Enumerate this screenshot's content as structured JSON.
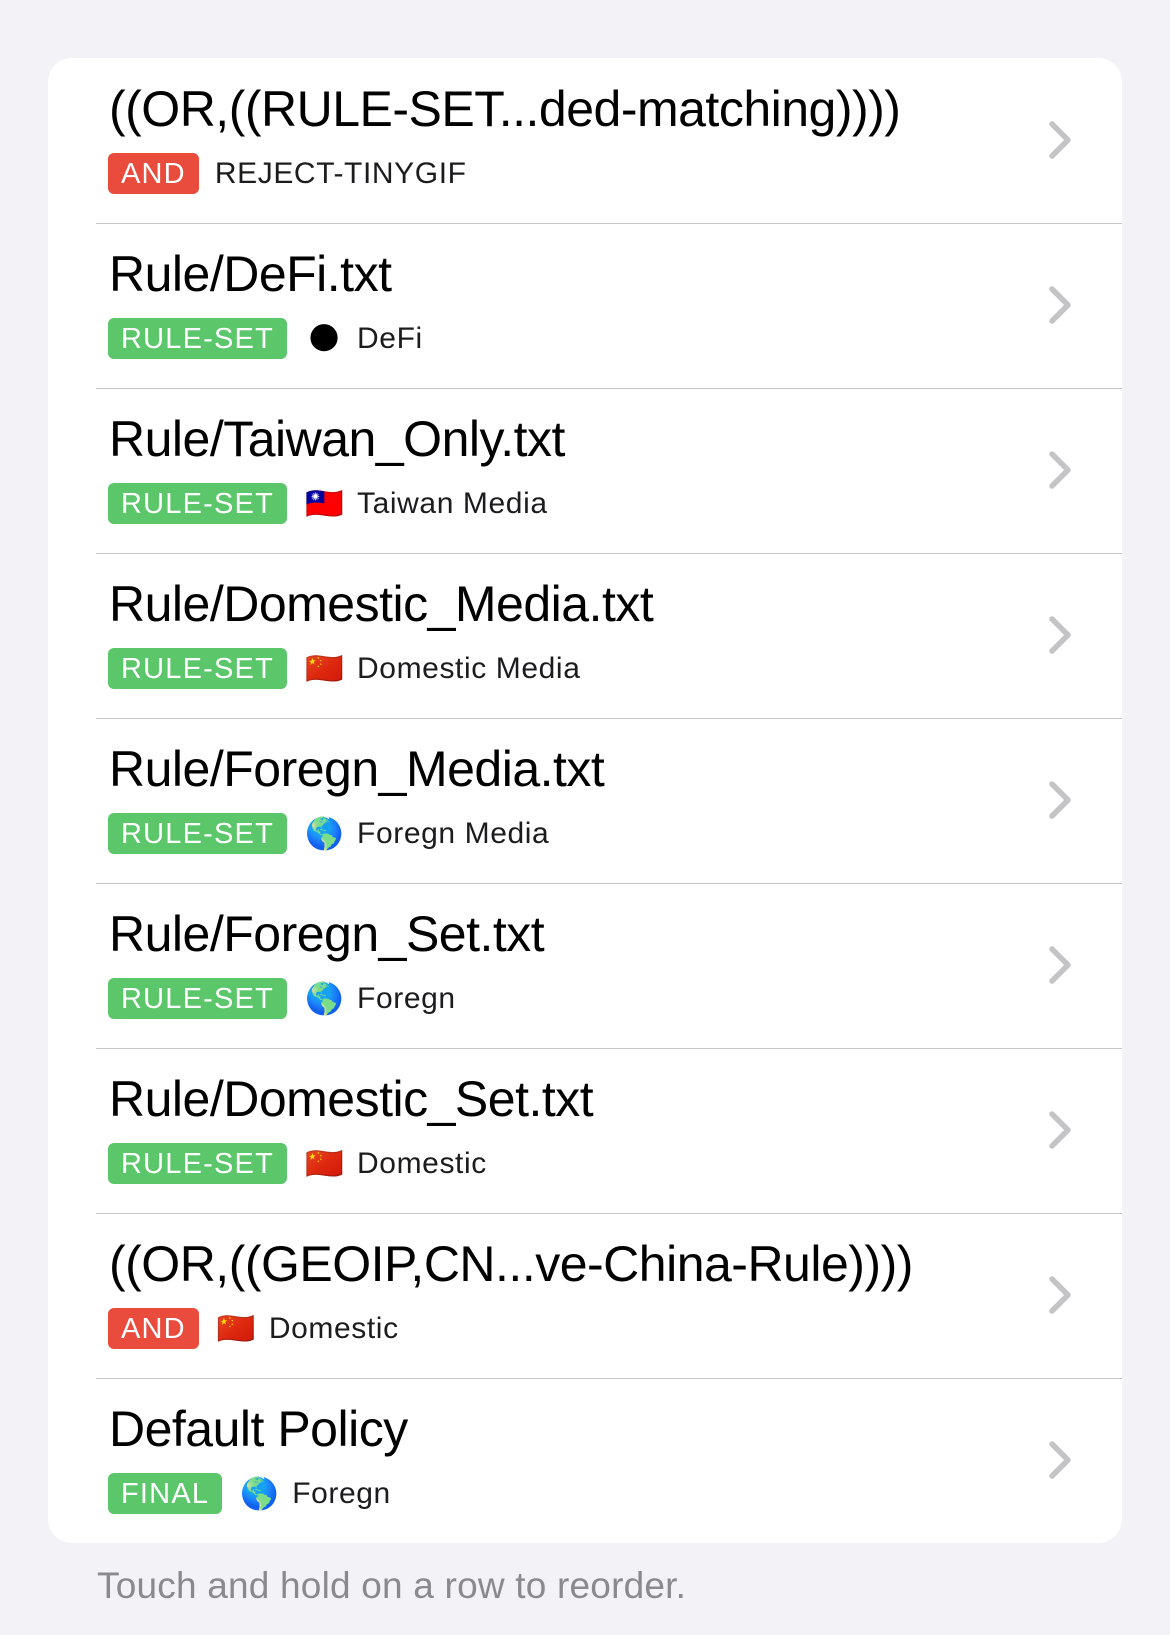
{
  "rules": [
    {
      "title": "((OR,((RULE-SET...ded-matching))))",
      "type": "AND",
      "type_color": "#e94b3c",
      "flag": "",
      "policy": "REJECT-TINYGIF"
    },
    {
      "title": "Rule/DeFi.txt",
      "type": "RULE-SET",
      "type_color": "#5cc66a",
      "flag": "🌑",
      "policy": "DeFi"
    },
    {
      "title": "Rule/Taiwan_Only.txt",
      "type": "RULE-SET",
      "type_color": "#5cc66a",
      "flag": "🇹🇼",
      "policy": "Taiwan Media"
    },
    {
      "title": "Rule/Domestic_Media.txt",
      "type": "RULE-SET",
      "type_color": "#5cc66a",
      "flag": "🇨🇳",
      "policy": "Domestic Media"
    },
    {
      "title": "Rule/Foregn_Media.txt",
      "type": "RULE-SET",
      "type_color": "#5cc66a",
      "flag": "🌎",
      "policy": "Foregn Media"
    },
    {
      "title": "Rule/Foregn_Set.txt",
      "type": "RULE-SET",
      "type_color": "#5cc66a",
      "flag": "🌎",
      "policy": "Foregn"
    },
    {
      "title": "Rule/Domestic_Set.txt",
      "type": "RULE-SET",
      "type_color": "#5cc66a",
      "flag": "🇨🇳",
      "policy": "Domestic"
    },
    {
      "title": "((OR,((GEOIP,CN...ve-China-Rule))))",
      "type": "AND",
      "type_color": "#e94b3c",
      "flag": "🇨🇳",
      "policy": "Domestic"
    },
    {
      "title": "Default Policy",
      "type": "FINAL",
      "type_color": "#5cc66a",
      "flag": "🌎",
      "policy": "Foregn"
    }
  ],
  "footer": "Touch and hold on a row to reorder.",
  "icons": {
    "chevron": "chevron-right-icon"
  }
}
